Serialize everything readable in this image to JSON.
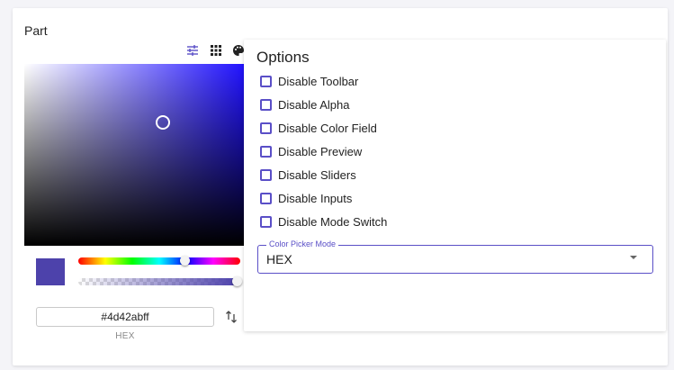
{
  "part": {
    "title": "Part"
  },
  "toolbar": {
    "icons": [
      "sliders-icon",
      "grid-icon",
      "palette-icon"
    ]
  },
  "color": {
    "hex_value": "#4d42abff",
    "format_label": "HEX",
    "preview_color": "#4d42ab",
    "hue_level": 0.66,
    "alpha_level": 1.0
  },
  "options": {
    "title": "Options",
    "items": [
      {
        "label": "Disable Toolbar",
        "checked": false
      },
      {
        "label": "Disable Alpha",
        "checked": false
      },
      {
        "label": "Disable Color Field",
        "checked": false
      },
      {
        "label": "Disable Preview",
        "checked": false
      },
      {
        "label": "Disable Sliders",
        "checked": false
      },
      {
        "label": "Disable Inputs",
        "checked": false
      },
      {
        "label": "Disable Mode Switch",
        "checked": false
      }
    ]
  },
  "mode_select": {
    "label": "Color Picker Mode",
    "value": "HEX"
  },
  "colors": {
    "accent": "#5a4fc7"
  }
}
